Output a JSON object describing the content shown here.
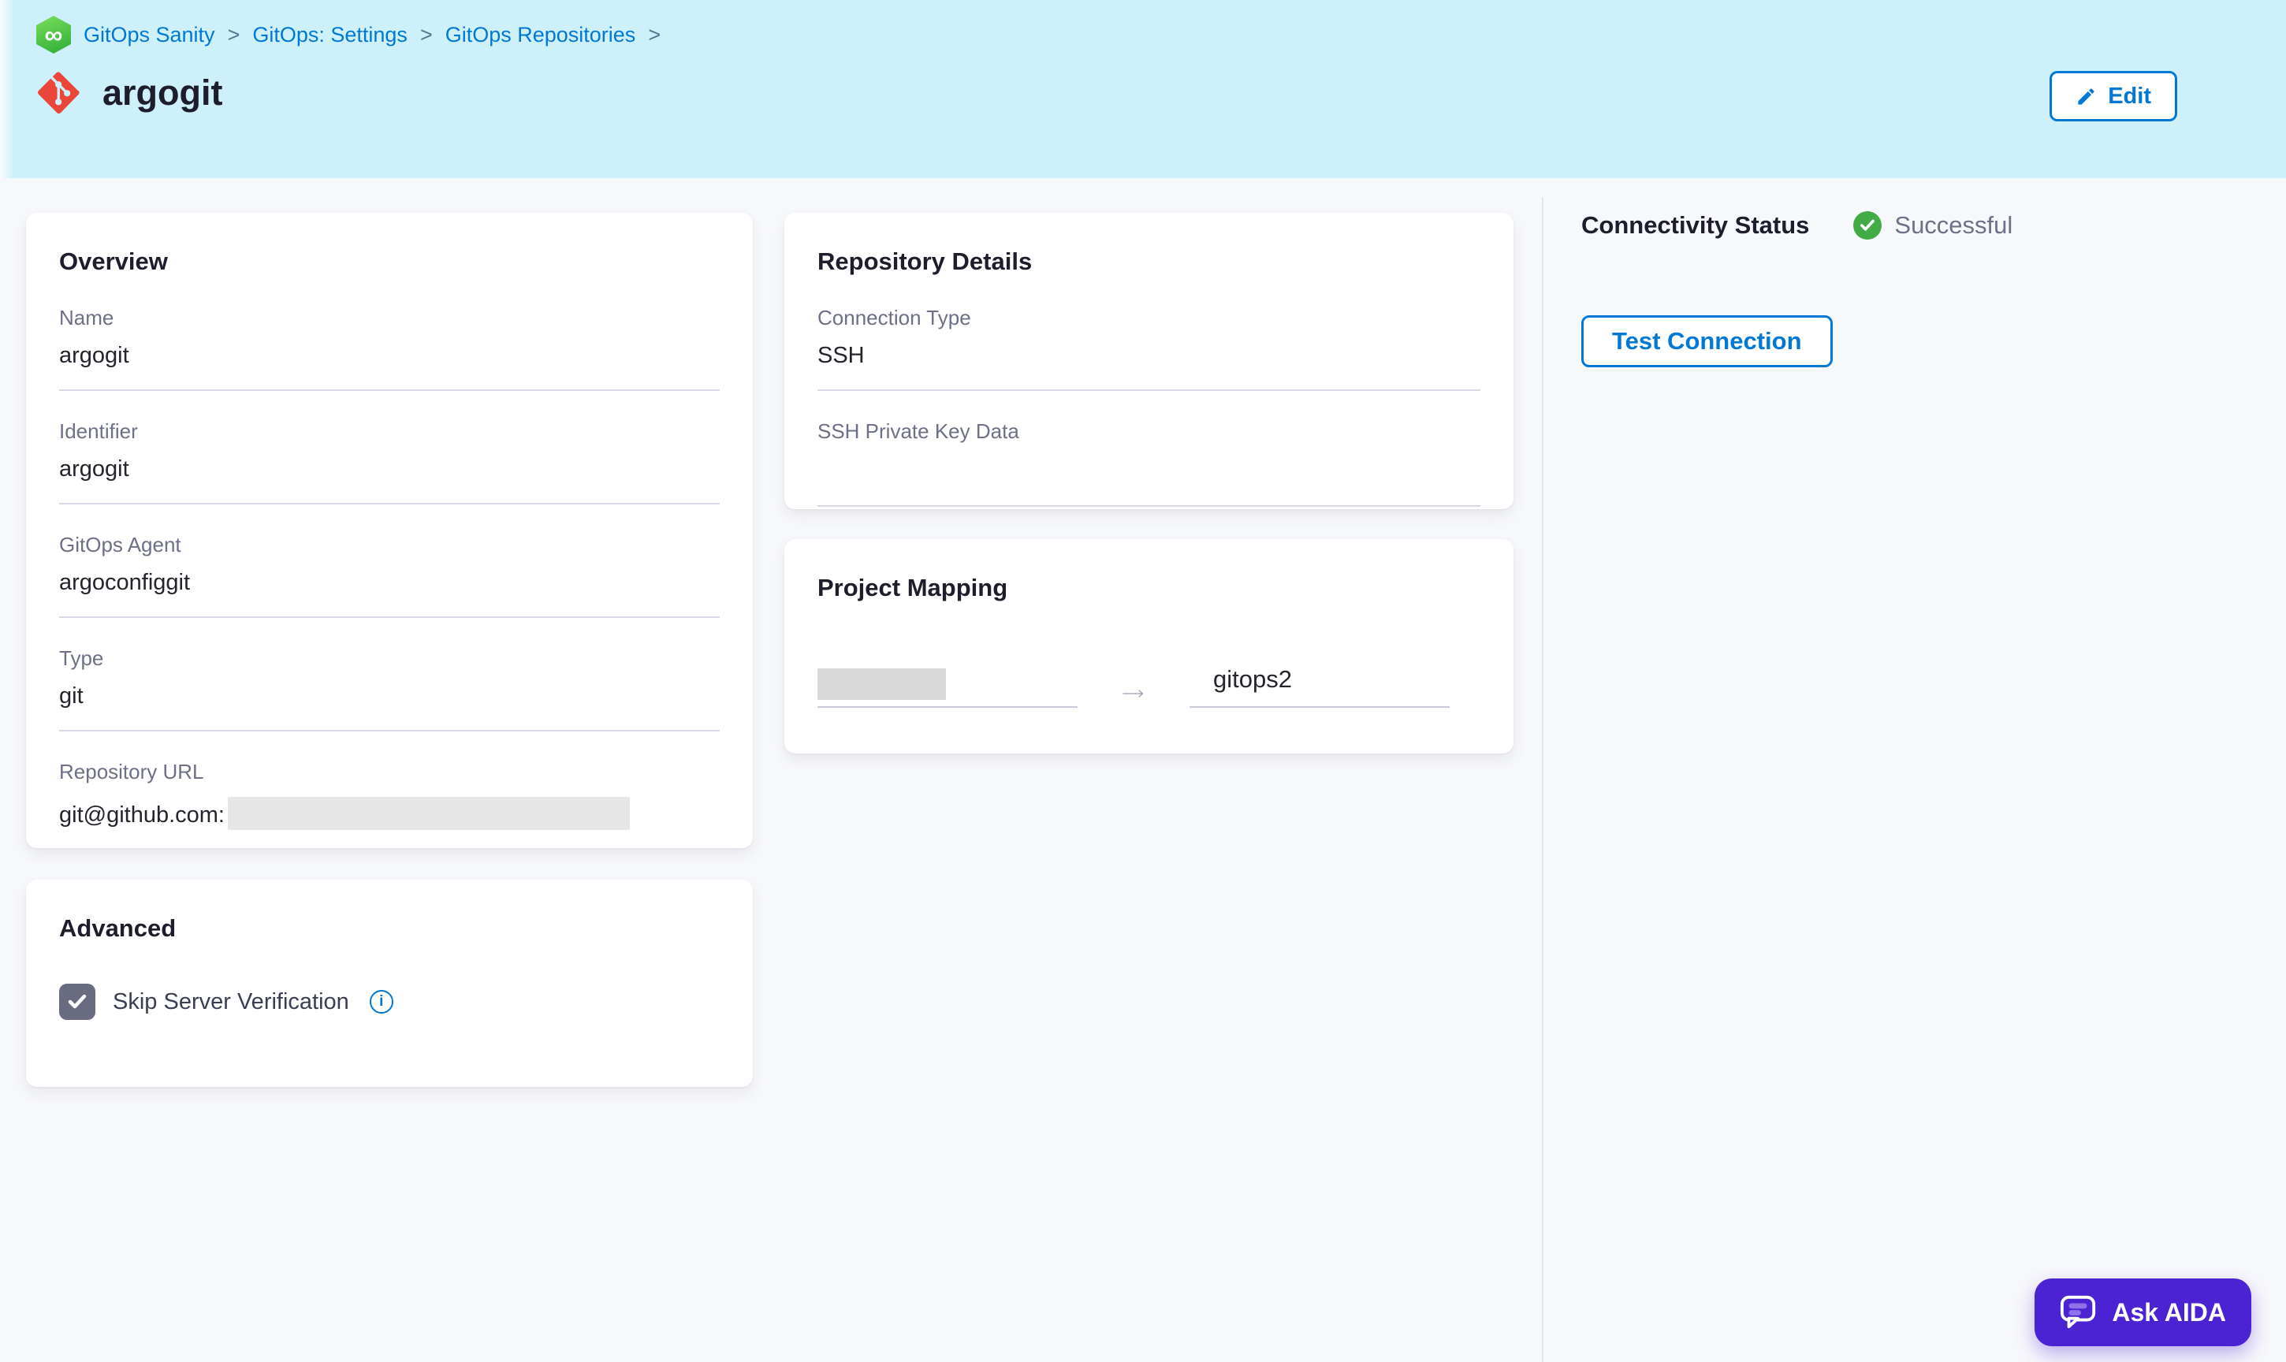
{
  "header": {
    "breadcrumb": {
      "items": [
        "GitOps Sanity",
        "GitOps: Settings",
        "GitOps Repositories"
      ],
      "separator": ">"
    },
    "title": "argogit",
    "edit_button": "Edit"
  },
  "overview": {
    "title": "Overview",
    "fields": [
      {
        "label": "Name",
        "value": "argogit"
      },
      {
        "label": "Identifier",
        "value": "argogit"
      },
      {
        "label": "GitOps Agent",
        "value": "argoconfiggit"
      },
      {
        "label": "Type",
        "value": "git"
      },
      {
        "label": "Repository URL",
        "value": "git@github.com:",
        "redacted_suffix": true
      }
    ]
  },
  "repository_details": {
    "title": "Repository Details",
    "fields": [
      {
        "label": "Connection Type",
        "value": "SSH"
      },
      {
        "label": "SSH Private Key Data",
        "value": ""
      }
    ]
  },
  "project_mapping": {
    "title": "Project Mapping",
    "source_redacted": true,
    "target": "gitops2"
  },
  "advanced": {
    "title": "Advanced",
    "checkbox_label": "Skip Server Verification",
    "checked": true
  },
  "connectivity": {
    "label": "Connectivity Status",
    "status": "Successful",
    "test_button": "Test Connection"
  },
  "aida": {
    "label": "Ask AIDA"
  },
  "colors": {
    "header_background": "#cdf0fb",
    "page_background": "#f7f8fb",
    "accent_blue": "#0278d5",
    "status_green": "#42ab45",
    "aida_purple": "#4b23d3",
    "git_red": "#ea4639",
    "gitops_green": "#4cc43f",
    "label_gray": "#6d7086"
  }
}
